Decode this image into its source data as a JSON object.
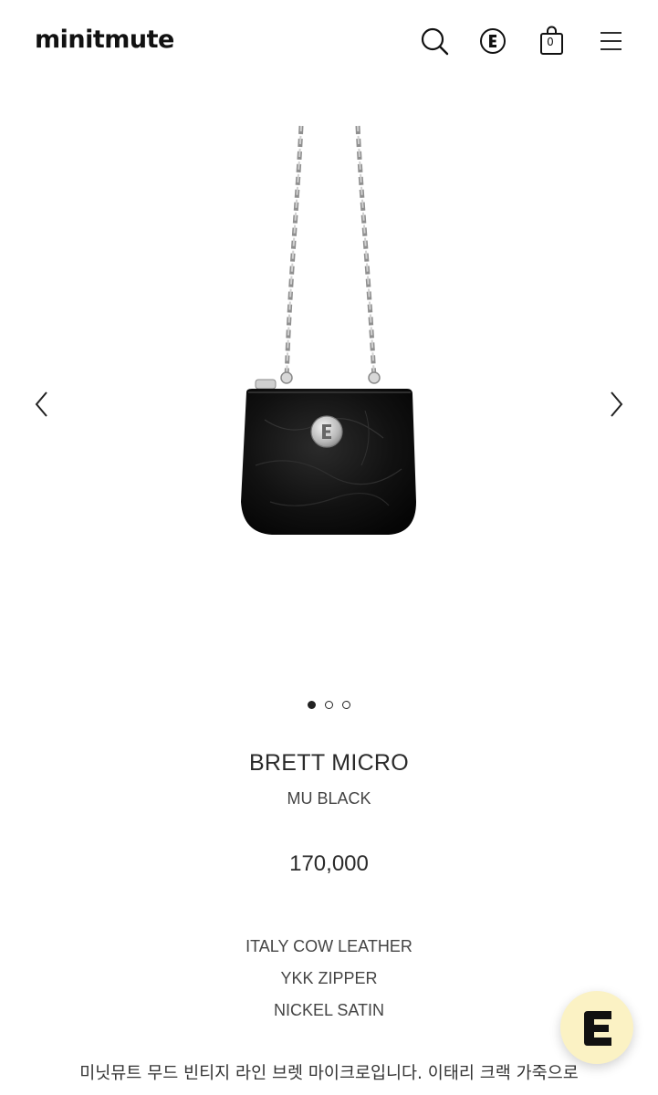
{
  "header": {
    "logo": "minitmute",
    "icons": [
      "search-icon",
      "brand-e-icon",
      "cart-icon",
      "menu-icon"
    ],
    "cart_count": "0"
  },
  "carousel": {
    "slide_count": 3,
    "active_index": 0,
    "prev_icon": "chevron-left-icon",
    "next_icon": "chevron-right-icon"
  },
  "product": {
    "name": "BRETT MICRO",
    "color": "MU BLACK",
    "price": "170,000",
    "specs": [
      "ITALY COW LEATHER",
      "YKK ZIPPER",
      "NICKEL SATIN"
    ],
    "description": "미닛뮤트 무드 빈티지 라인 브렛 마이크로입니다. 이태리 크랙 가죽으로"
  },
  "chat_widget": {
    "icon": "chat-e-icon",
    "background": "#fbf2c4"
  }
}
